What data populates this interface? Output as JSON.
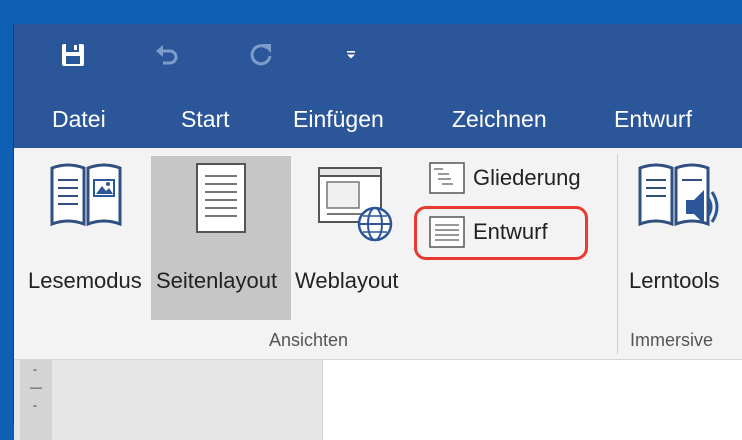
{
  "quick_access": {
    "save_icon": "save-icon",
    "undo_icon": "undo-icon",
    "redo_icon": "redo-icon",
    "customize_icon": "customize-qat-icon"
  },
  "tabs": [
    "Datei",
    "Start",
    "Einfügen",
    "Zeichnen",
    "Entwurf"
  ],
  "ribbon": {
    "ansichten": {
      "label": "Ansichten",
      "lesemodus": "Lesemodus",
      "seitenlayout": "Seitenlayout",
      "weblayout": "Weblayout",
      "gliederung": "Gliederung",
      "entwurf": "Entwurf"
    },
    "immersive": {
      "label": "Immersive",
      "lerntools": "Lerntools"
    }
  },
  "ruler_marks": [
    "-",
    "—",
    "-"
  ],
  "colors": {
    "title_bar": "#2b579a",
    "ribbon": "#f3f3f3",
    "selected": "#c6c6c6",
    "highlight": "#e83a2e"
  }
}
